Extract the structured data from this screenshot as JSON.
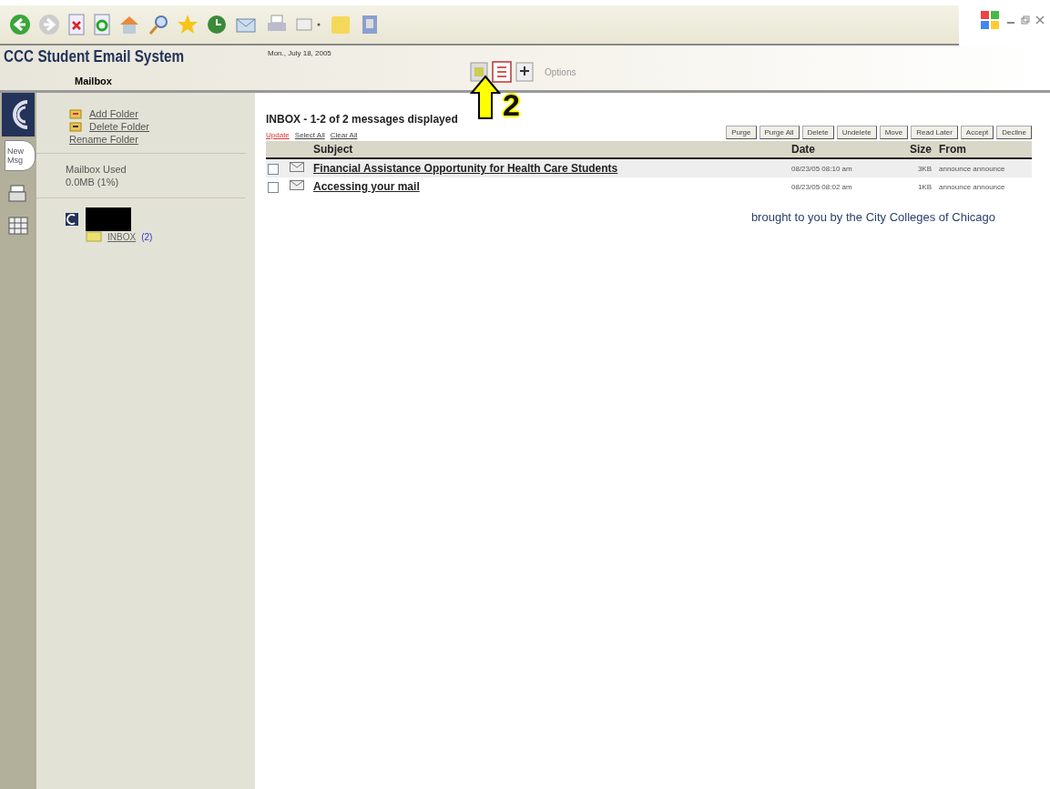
{
  "header": {
    "title": "CCC Student Email System",
    "section": "Mailbox",
    "date": "Mon., July 18, 2005",
    "options": "Options"
  },
  "annotation": {
    "label": "2"
  },
  "rail": {
    "new_msg": "New Msg"
  },
  "sidebar": {
    "folder_actions": [
      "Add Folder",
      "Delete Folder",
      "Rename Folder"
    ],
    "usage_label": "Mailbox Used",
    "usage_value": "0.0MB  (1%)",
    "folders": [
      {
        "name": "INBOX",
        "count": "(2)"
      }
    ]
  },
  "mailbox": {
    "title": "INBOX - 1-2 of 2 messages displayed",
    "links": [
      {
        "label": "Update",
        "kind": "alert"
      },
      {
        "label": "Select All",
        "kind": "plain"
      },
      {
        "label": "Clear All",
        "kind": "plain"
      }
    ],
    "buttons": [
      "Purge",
      "Purge All",
      "Delete",
      "Undelete",
      "Move",
      "Read Later",
      "Accept",
      "Decline"
    ],
    "columns": [
      "Subject",
      "Date",
      "Size",
      "From"
    ],
    "rows": [
      {
        "subject": "Financial Assistance Opportunity for Health Care Students",
        "date": "08/23/05 08:10 am",
        "size": "3KB",
        "from": "announce announce",
        "checked": false,
        "selected": true
      },
      {
        "subject": "Accessing your mail",
        "date": "08/23/05 08:02 am",
        "size": "1KB",
        "from": "announce announce",
        "checked": false,
        "selected": false
      }
    ]
  },
  "footer": "brought to you by the City Colleges of Chicago"
}
